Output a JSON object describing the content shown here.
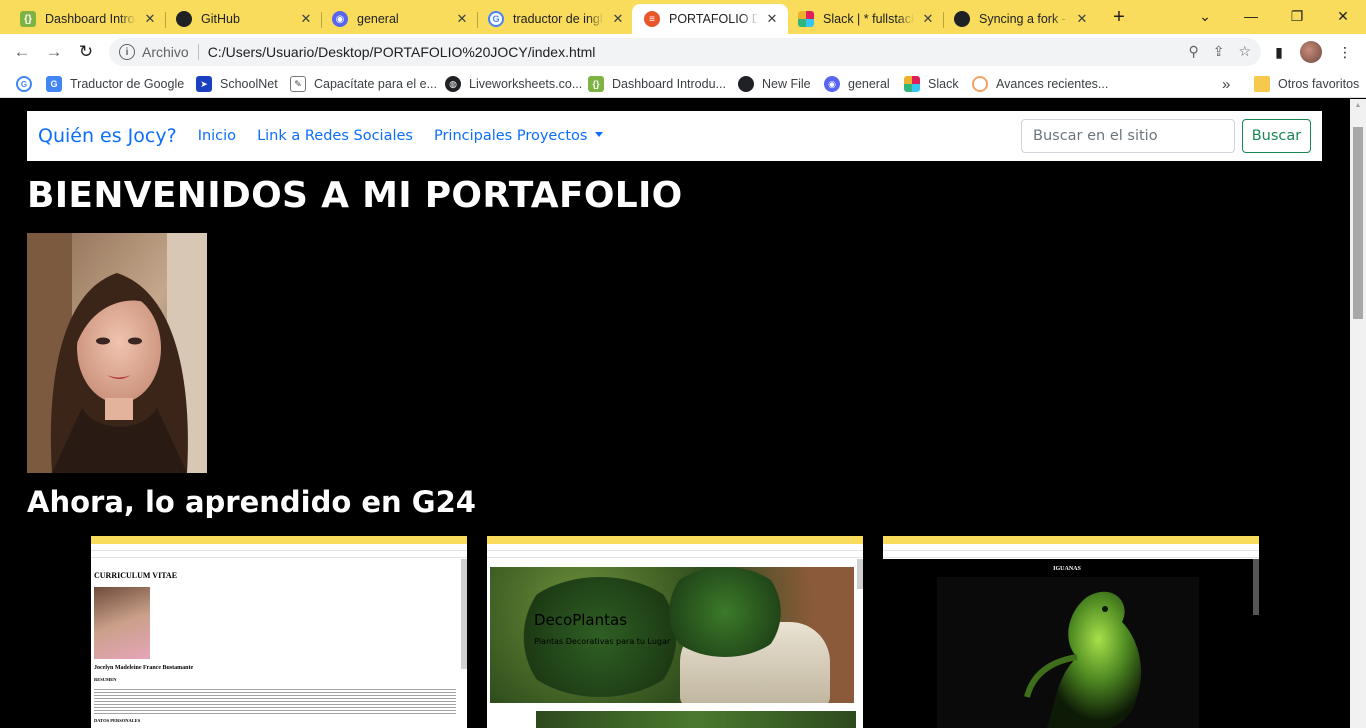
{
  "browser": {
    "tabs": [
      {
        "title": "Dashboard Introc",
        "icon": "dashboard-favicon-icon",
        "color": "#7cb342"
      },
      {
        "title": "GitHub",
        "icon": "github-icon",
        "color": "#202124"
      },
      {
        "title": "general",
        "icon": "discord-icon",
        "color": "#5865f2"
      },
      {
        "title": "traductor de ingl",
        "icon": "google-icon",
        "color": "#ffffff"
      },
      {
        "title": "PORTAFOLIO DE",
        "icon": "portfolio-favicon-icon",
        "color": "#e8572c"
      },
      {
        "title": "Slack | * fullstack",
        "icon": "slack-icon",
        "color": "#ffffff"
      },
      {
        "title": "Syncing a fork - G",
        "icon": "github-icon",
        "color": "#202124"
      }
    ],
    "address": {
      "scheme": "Archivo",
      "url": "C:/Users/Usuario/Desktop/PORTAFOLIO%20JOCY/index.html"
    },
    "bookmarks": [
      {
        "label": "Traductor de Google",
        "icon": "google-translate-icon"
      },
      {
        "label": "SchoolNet",
        "icon": "schoolnet-icon"
      },
      {
        "label": "Capacítate para el e...",
        "icon": "edit-doc-icon"
      },
      {
        "label": "Liveworksheets.co...",
        "icon": "globe-icon"
      },
      {
        "label": "Dashboard Introdu...",
        "icon": "dashboard-favicon-icon"
      },
      {
        "label": "New File",
        "icon": "github-icon"
      },
      {
        "label": "general",
        "icon": "discord-icon"
      },
      {
        "label": "Slack",
        "icon": "slack-icon"
      },
      {
        "label": "Avances recientes...",
        "icon": "avances-icon"
      }
    ],
    "other_bookmarks": "Otros favoritos",
    "overflow": "»"
  },
  "page": {
    "navbar": {
      "brand": "Quién es Jocy?",
      "links": [
        "Inicio",
        "Link a Redes Sociales",
        "Principales Proyectos"
      ],
      "search_placeholder": "Buscar en el sitio",
      "search_button": "Buscar"
    },
    "heading": "BIENVENIDOS A MI PORTAFOLIO",
    "subheading": "Ahora, lo aprendido en G24",
    "projects": [
      {
        "name": "curriculum-screenshot",
        "title": "CURRICULUM VITAE",
        "person": "Jocelyn Madeleine France Bustamante",
        "section1": "RESUMEN",
        "section2": "DATOS PERSONALES"
      },
      {
        "name": "decoplantas-screenshot",
        "title": "DecoPlantas",
        "caption": "Plantas Decorativas para tu Lugar"
      },
      {
        "name": "iguanas-screenshot",
        "title": "IGUANAS"
      }
    ]
  }
}
